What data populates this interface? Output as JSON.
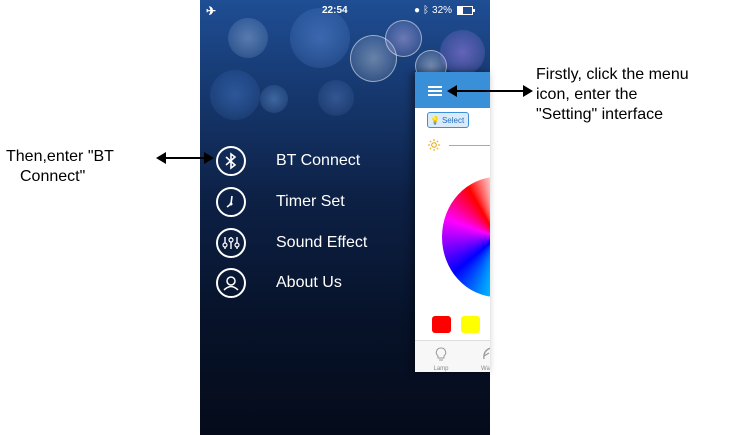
{
  "status_bar": {
    "time": "22:54",
    "battery": "32%",
    "battery_level": 0.32
  },
  "menu": {
    "items": [
      {
        "label": "BT Connect",
        "icon": "bluetooth-icon"
      },
      {
        "label": "Timer Set",
        "icon": "clock-icon"
      },
      {
        "label": "Sound Effect",
        "icon": "equalizer-icon"
      },
      {
        "label": "About Us",
        "icon": "user-icon"
      }
    ]
  },
  "panel": {
    "header_color": "#3a8fd9",
    "select_label": "Select",
    "swatches": [
      "#ff0000",
      "#ffff00",
      "#00cc00"
    ],
    "tabs": [
      {
        "label": "Lamp",
        "icon": "lamp-icon"
      },
      {
        "label": "Wa",
        "icon": "feather-icon"
      }
    ]
  },
  "annotations": {
    "right_text": [
      "Firstly, click the menu",
      "icon, enter the",
      "\"Setting\" interface"
    ],
    "left_text": [
      "Then,enter \"BT",
      "Connect\""
    ]
  }
}
